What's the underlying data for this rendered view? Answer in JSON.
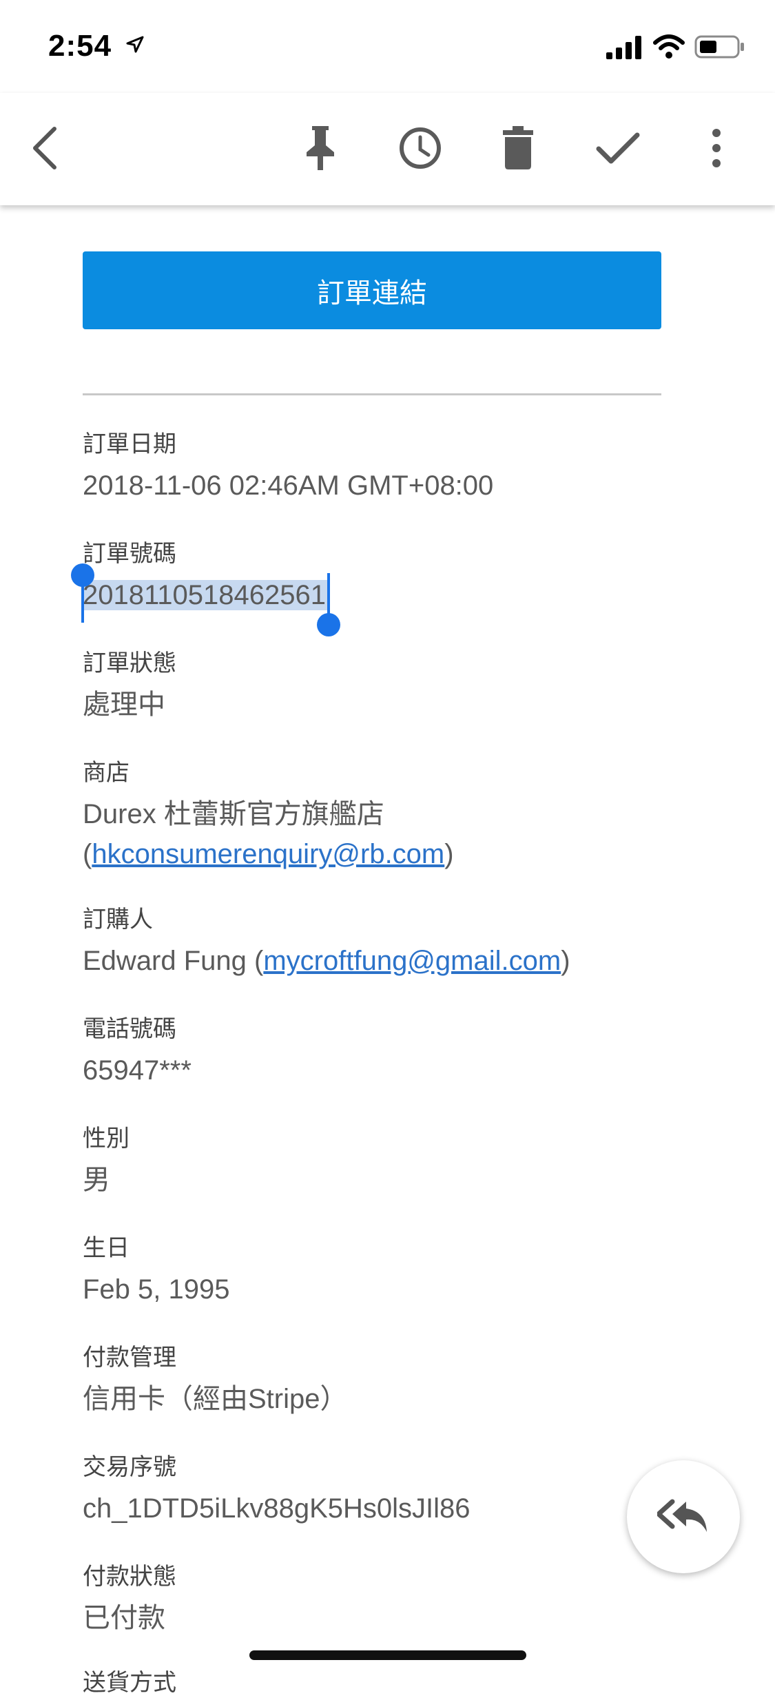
{
  "status_bar": {
    "time": "2:54"
  },
  "toolbar": {
    "back_icon": "chevron-left-icon",
    "pin_icon": "pin-icon",
    "snooze_icon": "clock-icon",
    "delete_icon": "trash-icon",
    "done_icon": "check-icon",
    "more_icon": "more-vertical-icon"
  },
  "email": {
    "order_link_button": "訂單連結",
    "fields": [
      {
        "label": "訂單日期",
        "value": "2018-11-06 02:46AM GMT+08:00"
      },
      {
        "label": "訂單號碼",
        "value": "2018110518462561"
      },
      {
        "label": "訂單狀態",
        "value": "處理中"
      },
      {
        "label": "商店",
        "value": "Durex 杜蕾斯官方旗艦店",
        "paren_open": "(",
        "link": "hkconsumerenquiry@rb.com",
        "paren_close": ")"
      },
      {
        "label": "訂購人",
        "value": "Edward Fung (",
        "link": "mycroftfung@gmail.com",
        "paren_close": ")"
      },
      {
        "label": "電話號碼",
        "value": "65947***"
      },
      {
        "label": "性別",
        "value": "男"
      },
      {
        "label": "生日",
        "value": "Feb 5, 1995"
      },
      {
        "label": "付款管理",
        "value": "信用卡（經由Stripe）"
      },
      {
        "label": "交易序號",
        "value": "ch_1DTD5iLkv88gK5Hs0lsJIl86"
      },
      {
        "label": "付款狀態",
        "value": "已付款"
      },
      {
        "label": "送貨方式"
      }
    ]
  },
  "reply_all_icon": "reply-all-icon",
  "colors": {
    "button_blue": "#0b8ce0",
    "link_blue": "#2b72c9",
    "selection_highlight": "#c7d9f0",
    "selection_handle": "#1a73e8"
  }
}
